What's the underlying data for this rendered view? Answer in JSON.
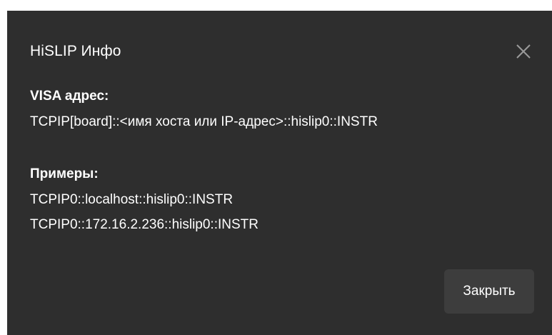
{
  "dialog": {
    "title": "HiSLIP Инфо",
    "close_icon": "close-icon",
    "visa_section": {
      "label": "VISA адрес:",
      "value": "TCPIP[board]::<имя хоста или IP-адрес>::hislip0::INSTR"
    },
    "examples_section": {
      "label": "Примеры:",
      "items": [
        "TCPIP0::localhost::hislip0::INSTR",
        "TCPIP0::172.16.2.236::hislip0::INSTR"
      ]
    },
    "close_button_label": "Закрыть"
  },
  "colors": {
    "dialog_background": "#2e2e2e",
    "button_background": "#3d3d3d",
    "text": "#ffffff",
    "icon": "#9a9a9a"
  }
}
